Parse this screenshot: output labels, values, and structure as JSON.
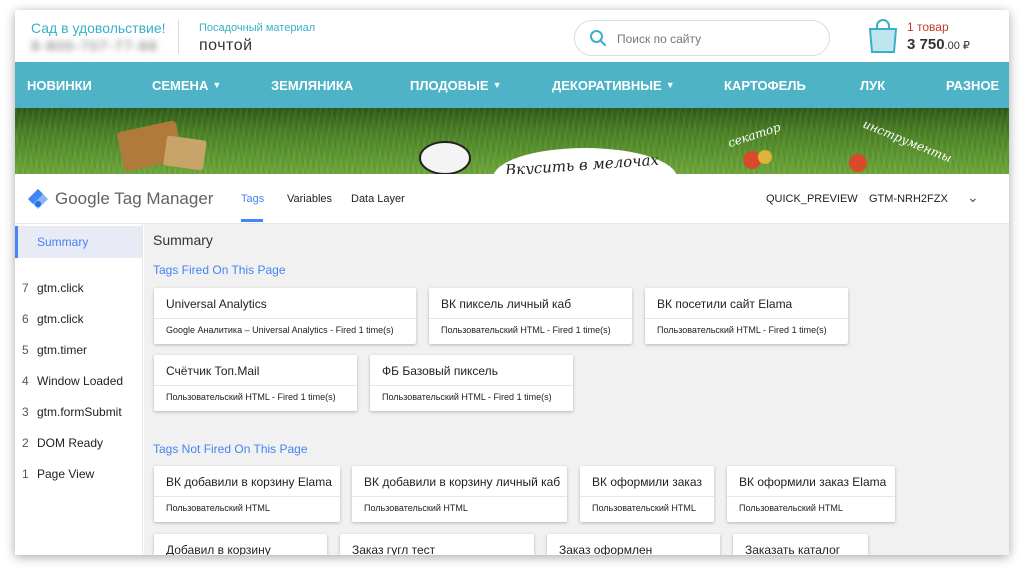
{
  "site": {
    "tagline": "Сад в удовольствие!",
    "phone": "8-800-707-77-88",
    "material_label": "Посадочный материал",
    "material_value": "почтой",
    "search_placeholder": "Поиск по сайту",
    "cart_count": "1 товар",
    "cart_total": "3 750",
    "cart_cents": ".00 ₽"
  },
  "nav": [
    {
      "label": "НОВИНКИ",
      "dropdown": false
    },
    {
      "label": "СЕМЕНА",
      "dropdown": true
    },
    {
      "label": "ЗЕМЛЯНИКА",
      "dropdown": false
    },
    {
      "label": "ПЛОДОВЫЕ",
      "dropdown": true
    },
    {
      "label": "ДЕКОРАТИВНЫЕ",
      "dropdown": true
    },
    {
      "label": "КАРТОФЕЛЬ",
      "dropdown": false
    },
    {
      "label": "ЛУК",
      "dropdown": false
    },
    {
      "label": "РАЗНОЕ",
      "dropdown": false
    }
  ],
  "banner": {
    "text1": "Вкусить в мелочах",
    "text2": "секатор",
    "text3": "инструменты"
  },
  "gtm": {
    "title": "Google Tag Manager",
    "tabs": [
      "Tags",
      "Variables",
      "Data Layer"
    ],
    "quick_preview": "QUICK_PREVIEW",
    "container_id": "GTM-NRH2FZX",
    "colors": {
      "accent": "#4285f4",
      "nav": "#4fb3c7"
    },
    "sidebar": {
      "summary": "Summary",
      "events": [
        {
          "num": "7",
          "label": "gtm.click"
        },
        {
          "num": "6",
          "label": "gtm.click"
        },
        {
          "num": "5",
          "label": "gtm.timer"
        },
        {
          "num": "4",
          "label": "Window Loaded"
        },
        {
          "num": "3",
          "label": "gtm.formSubmit"
        },
        {
          "num": "2",
          "label": "DOM Ready"
        },
        {
          "num": "1",
          "label": "Page View"
        }
      ]
    },
    "main_title": "Summary",
    "fired_title": "Tags Fired On This Page",
    "fired": [
      {
        "name": "Universal Analytics",
        "desc": "Google Аналитика – Universal Analytics - Fired 1 time(s)"
      },
      {
        "name": "ВК пиксель личный каб",
        "desc": "Пользовательский HTML - Fired 1 time(s)"
      },
      {
        "name": "ВК посетили сайт Elama",
        "desc": "Пользовательский HTML - Fired 1 time(s)"
      },
      {
        "name": "Счётчик Топ.Mail",
        "desc": "Пользовательский HTML - Fired 1 time(s)"
      },
      {
        "name": "ФБ Базовый пиксель",
        "desc": "Пользовательский HTML - Fired 1 time(s)"
      }
    ],
    "not_fired_title": "Tags Not Fired On This Page",
    "not_fired": [
      {
        "name": "ВК добавили в корзину Elama",
        "desc": "Пользовательский HTML"
      },
      {
        "name": "ВК добавили в корзину личный каб",
        "desc": "Пользовательский HTML"
      },
      {
        "name": "ВК оформили заказ",
        "desc": "Пользовательский HTML"
      },
      {
        "name": "ВК оформили заказ Elama",
        "desc": "Пользовательский HTML"
      },
      {
        "name": "Добавил в корзину",
        "desc": ""
      },
      {
        "name": "Заказ гугл тест",
        "desc": ""
      },
      {
        "name": "Заказ оформлен",
        "desc": ""
      },
      {
        "name": "Заказать каталог",
        "desc": ""
      }
    ]
  }
}
